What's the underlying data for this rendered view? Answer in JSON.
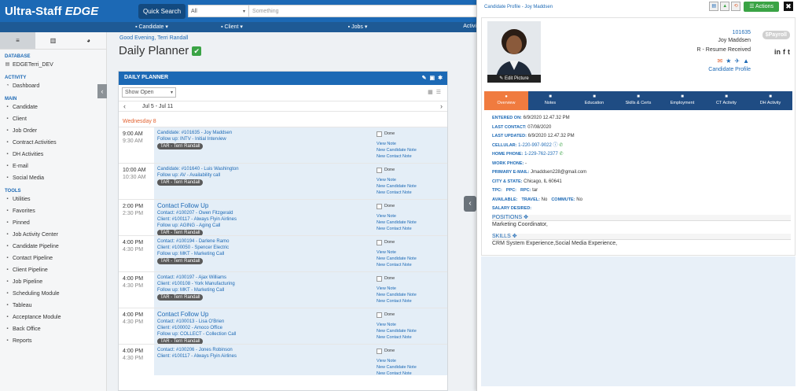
{
  "app": {
    "brand_main": "Ultra-Staff",
    "brand_edge": "EDGE",
    "quick_search_label": "Quick Search",
    "search_scope": "All",
    "search_placeholder": "Something"
  },
  "nav": {
    "items": [
      "Candidate",
      "Client",
      "Jobs",
      "Activi"
    ]
  },
  "sidebar": {
    "sections": {
      "database": "DATABASE",
      "activity": "ACTIVITY",
      "main": "MAIN",
      "tools": "TOOLS"
    },
    "database_name": "EDGETerri_DEV",
    "activity_items": [
      "Dashboard"
    ],
    "main_items": [
      "Candidate",
      "Client",
      "Job Order",
      "Contract Activities",
      "DH Activities",
      "E-mail",
      "Social Media"
    ],
    "tools_items": [
      "Utilities",
      "Favorites",
      "Pinned",
      "Job Activity Center",
      "Candidate Pipeline",
      "Contact Pipeline",
      "Client Pipeline",
      "Job Pipeline",
      "Scheduling Module",
      "Tableau",
      "Acceptance Module",
      "Back Office",
      "Reports"
    ]
  },
  "main": {
    "greeting": "Good Evening, Terri Randall",
    "title": "Daily Planner",
    "panel_title": "DAILY PLANNER",
    "filter": "Show Open",
    "date_range": "Jul 5 - Jul 11",
    "day_label": "Wednesday 8",
    "done_label": "Done",
    "view_note": "View Note",
    "new_candidate_note": "New Candidate Note",
    "new_contact_note": "New Contact Note",
    "appointments": [
      {
        "start": "9:00 AM",
        "end": "9:30 AM",
        "head": "",
        "lines": [
          {
            "label": "Candidate:",
            "value": "#101635 - Joy Maddsen"
          },
          {
            "label": "Follow up:",
            "value": "INTV - Initial Interview"
          }
        ],
        "tag": "TAR - Terri Randall"
      },
      {
        "start": "10:00 AM",
        "end": "10:30 AM",
        "head": "",
        "lines": [
          {
            "label": "Candidate:",
            "value": "#101640 - Luis Washington"
          },
          {
            "label": "Follow up:",
            "value": "AV - Availability call"
          }
        ],
        "tag": "TAR - Terri Randall"
      },
      {
        "start": "2:00 PM",
        "end": "2:30 PM",
        "head": "Contact Follow Up",
        "lines": [
          {
            "label": "Contact:",
            "value": "#100207 - Owen Fitzgerald"
          },
          {
            "label": "Client:",
            "value": "#100117 - Always Flyin Airlines"
          },
          {
            "label": "Follow up:",
            "value": "AGING - Aging Call"
          }
        ],
        "tag": "TAR - Terri Randall"
      },
      {
        "start": "4:00 PM",
        "end": "4:30 PM",
        "head": "",
        "lines": [
          {
            "label": "Contact:",
            "value": "#100194 - Darlene Ramo"
          },
          {
            "label": "Client:",
            "value": "#100050 - Spencer Electric"
          },
          {
            "label": "Follow up:",
            "value": "MKT - Marketing Call"
          }
        ],
        "tag": "TAR - Terri Randall"
      },
      {
        "start": "4:00 PM",
        "end": "4:30 PM",
        "head": "",
        "lines": [
          {
            "label": "Contact:",
            "value": "#100197 - Ajax Williams"
          },
          {
            "label": "Client:",
            "value": "#100108 - York Manufacturing"
          },
          {
            "label": "Follow up:",
            "value": "MKT - Marketing Call"
          }
        ],
        "tag": "TAR - Terri Randall"
      },
      {
        "start": "4:00 PM",
        "end": "4:30 PM",
        "head": "Contact Follow Up",
        "lines": [
          {
            "label": "Contact:",
            "value": "#100013 - Lisa O'Brien"
          },
          {
            "label": "Client:",
            "value": "#100002 - Amoco Office"
          },
          {
            "label": "Follow up:",
            "value": "COLLECT - Collection Call"
          }
        ],
        "tag": "TAR - Terri Randall"
      },
      {
        "start": "4:00 PM",
        "end": "4:30 PM",
        "head": "",
        "lines": [
          {
            "label": "Contact:",
            "value": "#100206 - Jones Robinson"
          },
          {
            "label": "Client:",
            "value": "#100117 - Always Flyin Airlines"
          }
        ],
        "tag": ""
      }
    ]
  },
  "drawer": {
    "title": "Candidate Profile - Joy Maddsen",
    "actions_label": "Actions",
    "close_label": "✖",
    "edit_picture": "Edit Picture",
    "cand_id": "101635",
    "cand_name": "Joy Maddsen",
    "cand_status": "R - Resume Received",
    "payroll": "$Payroll",
    "candidate_profile_link": "Candidate Profile",
    "tabs": [
      "Overview",
      "Notes",
      "Education",
      "Skills & Certs",
      "Employment",
      "CT Activity",
      "DH Activity"
    ],
    "fields": {
      "entered_on_label": "ENTERED ON:",
      "entered_on": "6/9/2020 12.47.32 PM",
      "last_contact_label": "LAST CONTACT:",
      "last_contact": "07/08/2020",
      "last_updated_label": "LAST UPDATED:",
      "last_updated": "6/9/2020 12.47.32 PM",
      "cellular_label": "CELLULAR:",
      "cellular": "1-220-997-9022",
      "home_phone_label": "HOME PHONE:",
      "home_phone": "1-229-762-2377",
      "work_phone_label": "WORK PHONE:",
      "work_phone": "-",
      "email_label": "PRIMARY E-MAIL:",
      "email": "Jmaddsen228@gmail.com",
      "city_label": "CITY & STATE:",
      "city": "Chicago, IL 60641",
      "tpc_label": "TPC:",
      "ppc_label": "PPC:",
      "rpc_label": "RPC:",
      "rpc": "tar",
      "available_label": "AVAILABLE:",
      "travel_label": "TRAVEL:",
      "travel": "No",
      "commute_label": "COMMUTE:",
      "commute": "No",
      "salary_label": "SALARY DESIRED:"
    },
    "positions_title": "POSITIONS",
    "positions_value": "Marketing Coordinator,",
    "skills_title": "SKILLS",
    "skills_value": "CRM System Experience,Social Media Experience,"
  },
  "colors": {
    "brand_blue": "#1c69b5",
    "nav_blue": "#1e5a95",
    "accent_orange": "#f07b3f",
    "action_green": "#3aa345"
  }
}
